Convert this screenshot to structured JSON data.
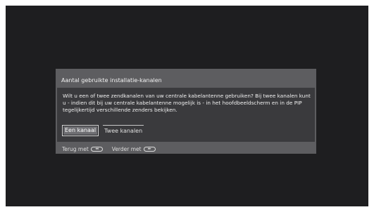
{
  "dialog": {
    "title": "Aantal gebruikte installatie-kanalen",
    "body": "Wilt u een of twee zendkanalen van uw centrale kabelantenne gebruiken? Bij twee kanalen kunt u - indien dit bij uw centrale kabelantenne mogelijk is - in het hoofdbeeldscherm en in de PIP tegelijkertijd verschillende zenders bekijken.",
    "options": [
      {
        "label": "Een kanaal",
        "selected": true
      },
      {
        "label": "Twee kanalen",
        "selected": false
      }
    ]
  },
  "footer": {
    "back_label": "Terug met",
    "back_icon": "rewind-button-icon",
    "back_glyph": "◂◂",
    "next_label": "Verder met",
    "next_icon": "forward-button-icon",
    "next_glyph": "▸▸"
  },
  "colors": {
    "screen_bg": "#1e1e20",
    "dialog_bg": "#5d5d60",
    "body_bg": "#3a3a3d"
  }
}
